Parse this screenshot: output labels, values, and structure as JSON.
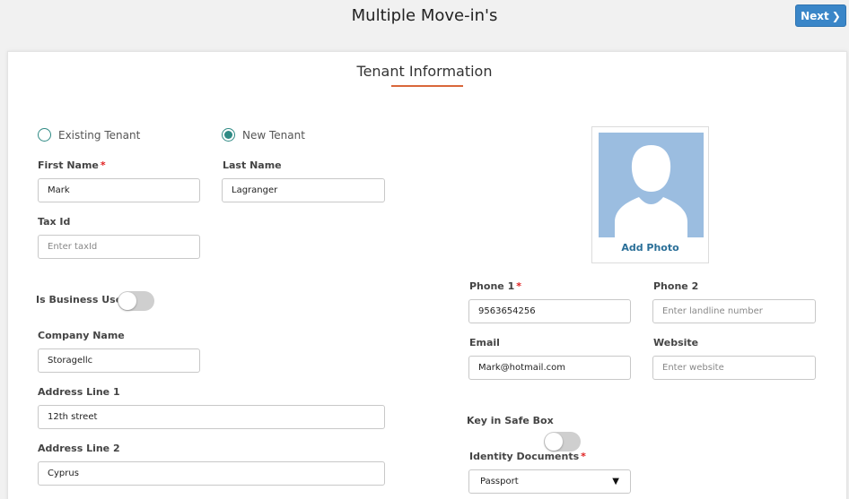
{
  "header": {
    "title": "Multiple Move-in's",
    "next_label": "Next"
  },
  "section": {
    "title": "Tenant Information"
  },
  "tenant_type": {
    "existing_label": "Existing Tenant",
    "new_label": "New Tenant",
    "selected": "New Tenant"
  },
  "fields": {
    "first_name": {
      "label": "First Name",
      "required": "*",
      "value": "Mark"
    },
    "last_name": {
      "label": "Last Name",
      "value": "Lagranger"
    },
    "tax_id": {
      "label": "Tax Id",
      "placeholder": "Enter taxId"
    },
    "business_user": {
      "label": "Is Business User",
      "on": false
    },
    "company_name": {
      "label": "Company Name",
      "value": "Storagellc"
    },
    "address1": {
      "label": "Address Line 1",
      "value": "12th street"
    },
    "address2": {
      "label": "Address Line 2",
      "value": "Cyprus"
    },
    "phone1": {
      "label": "Phone 1",
      "required": "*",
      "value": "9563654256"
    },
    "phone2": {
      "label": "Phone 2",
      "placeholder": "Enter landline number"
    },
    "email": {
      "label": "Email",
      "value": "Mark@hotmail.com"
    },
    "website": {
      "label": "Website",
      "placeholder": "Enter website"
    },
    "key_safe": {
      "label": "Key in Safe Box",
      "on": false
    },
    "identity_docs": {
      "label": "Identity Documents",
      "required": "*",
      "value": "Passport"
    }
  },
  "photo": {
    "add_label": "Add Photo",
    "icon": "user-avatar-icon"
  },
  "colors": {
    "accent": "#3a86c8",
    "underline": "#d9673a",
    "radio": "#2f8a84",
    "link": "#2a6f98",
    "required": "#e02020"
  }
}
